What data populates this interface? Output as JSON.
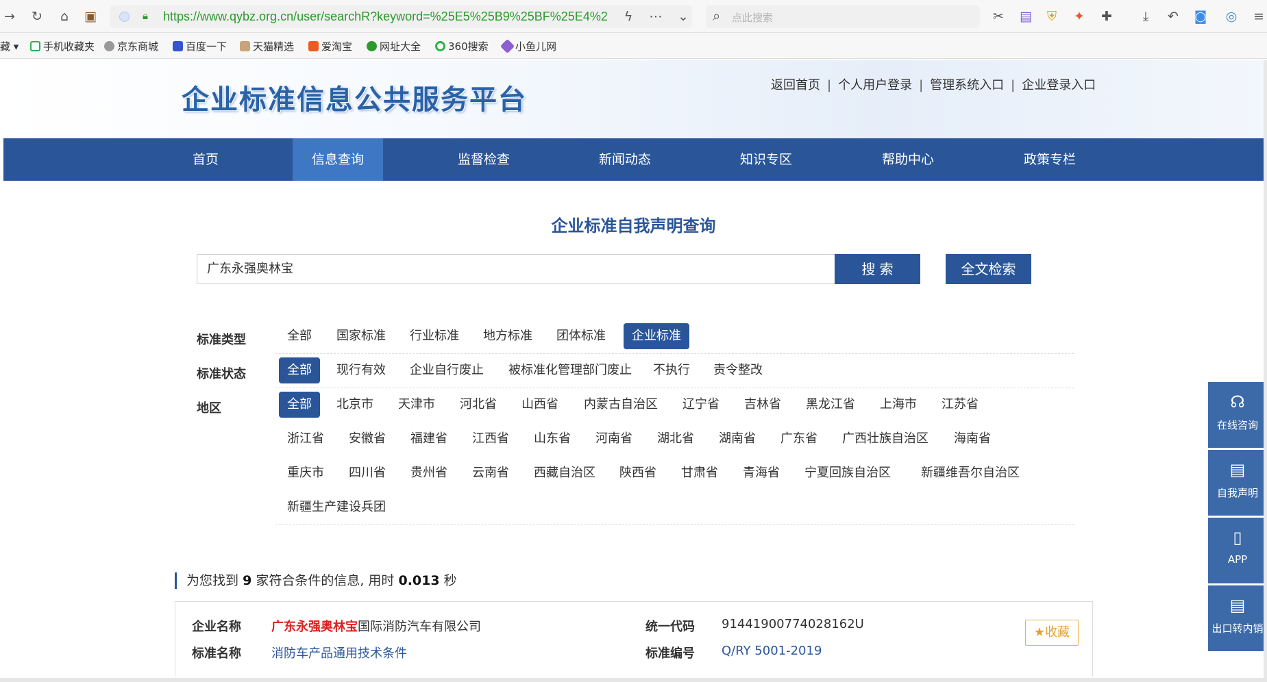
{
  "browser": {
    "url": "https://www.qybz.org.cn/user/searchR?keyword=%25E5%25B9%25BF%25E4%2",
    "search_placeholder": "点此搜索",
    "bookmarks": [
      "藏",
      "手机收藏夹",
      "京东商城",
      "百度一下",
      "天猫精选",
      "爱淘宝",
      "网址大全",
      "360搜索",
      "小鱼儿网"
    ]
  },
  "header": {
    "logo": "企业标准信息公共服务平台",
    "links": [
      "返回首页",
      "个人用户登录",
      "管理系统入口",
      "企业登录入口"
    ]
  },
  "nav": {
    "items": [
      "首页",
      "信息查询",
      "监督检查",
      "新闻动态",
      "知识专区",
      "帮助中心",
      "政策专栏"
    ],
    "active": "信息查询"
  },
  "search": {
    "title": "企业标准自我声明查询",
    "keyword": "广东永强奥林宝",
    "search_button": "搜 索",
    "fulltext_button": "全文检索"
  },
  "filters": {
    "type_label": "标准类型",
    "types": [
      "全部",
      "国家标准",
      "行业标准",
      "地方标准",
      "团体标准",
      "企业标准"
    ],
    "type_selected": "企业标准",
    "status_label": "标准状态",
    "statuses": [
      "全部",
      "现行有效",
      "企业自行废止",
      "被标准化管理部门废止",
      "不执行",
      "责令整改"
    ],
    "status_selected": "全部",
    "region_label": "地区",
    "regions_row1": [
      "全部",
      "北京市",
      "天津市",
      "河北省",
      "山西省",
      "内蒙古自治区",
      "辽宁省",
      "吉林省",
      "黑龙江省",
      "上海市",
      "江苏省"
    ],
    "regions_row2": [
      "浙江省",
      "安徽省",
      "福建省",
      "江西省",
      "山东省",
      "河南省",
      "湖北省",
      "湖南省",
      "广东省",
      "广西壮族自治区",
      "海南省"
    ],
    "regions_row3": [
      "重庆市",
      "四川省",
      "贵州省",
      "云南省",
      "西藏自治区",
      "陕西省",
      "甘肃省",
      "青海省",
      "宁夏回族自治区",
      "新疆维吾尔自治区"
    ],
    "regions_row4": [
      "新疆生产建设兵团"
    ],
    "region_selected": "全部"
  },
  "results": {
    "prefix": "为您找到",
    "count": "9",
    "middle": "家符合条件的信息, 用时",
    "time": "0.013",
    "suffix": "秒",
    "item": {
      "company_label": "企业名称",
      "company_highlight": "广东永强奥林宝",
      "company_rest": "国际消防汽车有限公司",
      "code_label": "统一代码",
      "code": "91441900774028162U",
      "std_name_label": "标准名称",
      "std_name": "消防车产品通用技术条件",
      "std_no_label": "标准编号",
      "std_no": "Q/RY 5001-2019",
      "favorite": "收藏"
    }
  },
  "sidebar": {
    "items": [
      "在线咨询",
      "自我声明",
      "APP",
      "出口转内销"
    ]
  },
  "colors": {
    "primary": "#2a5699",
    "nav_active": "#3e78c4",
    "highlight": "#e02020"
  }
}
